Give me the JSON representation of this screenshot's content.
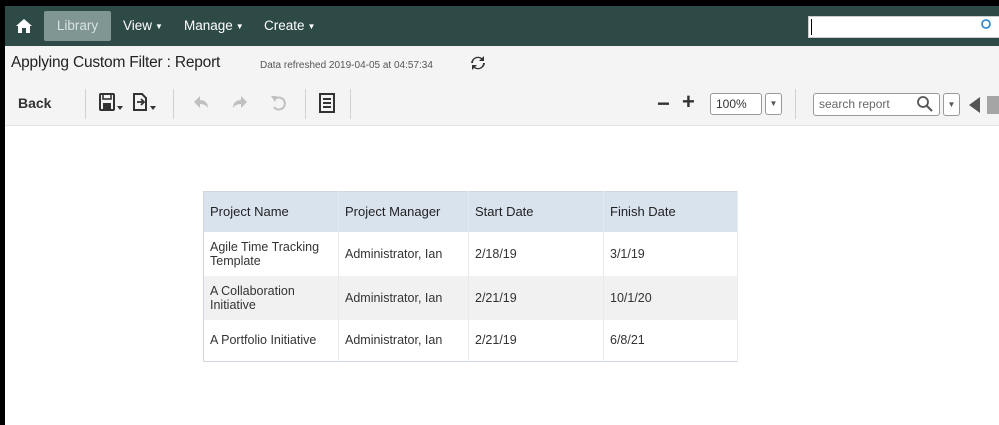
{
  "nav": {
    "home_icon": "home-icon",
    "library_label": "Library",
    "view_label": "View",
    "manage_label": "Manage",
    "create_label": "Create",
    "search_value": ""
  },
  "titlebar": {
    "title": "Applying Custom Filter : Report",
    "refreshed": "Data refreshed 2019-04-05 at 04:57:34",
    "refresh_icon": "refresh-icon"
  },
  "toolbar": {
    "back_label": "Back",
    "save_icon": "save-icon",
    "export_icon": "export-icon",
    "undo_icon": "undo-icon",
    "redo_icon": "redo-icon",
    "revert_icon": "revert-icon",
    "report_icon": "report-settings-icon",
    "zoom_out": "−",
    "zoom_in": "+",
    "zoom_value": "100%",
    "search_placeholder": "search report"
  },
  "table": {
    "headers": [
      "Project Name",
      "Project Manager",
      "Start Date",
      "Finish Date"
    ],
    "rows": [
      [
        "Agile Time Tracking Template",
        "Administrator, Ian",
        "2/18/19",
        "3/1/19"
      ],
      [
        "A Collaboration Initiative",
        "Administrator, Ian",
        "2/21/19",
        "10/1/20"
      ],
      [
        "A Portfolio Initiative",
        "Administrator, Ian",
        "2/21/19",
        "6/8/21"
      ]
    ]
  },
  "colors": {
    "nav_bg": "#2e4a47",
    "library_active": "#7f9693",
    "header_bg": "#d9e3ee"
  }
}
